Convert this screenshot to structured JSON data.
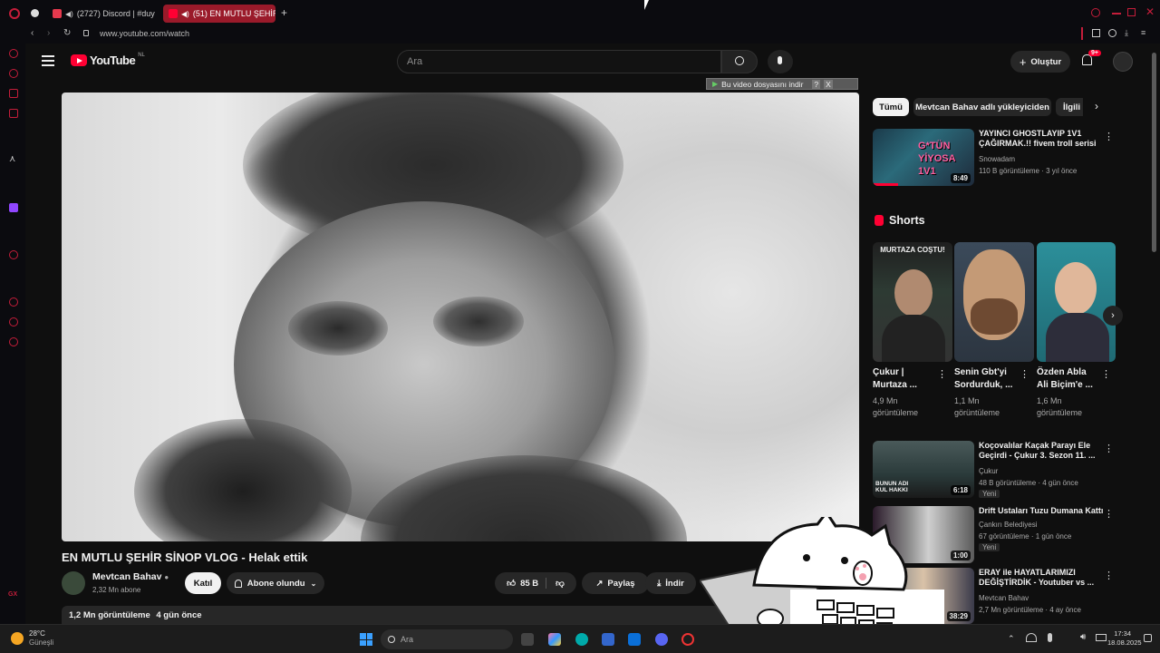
{
  "browser": {
    "tabs": [
      {
        "label": "(2727) Discord | #duy",
        "active": false
      },
      {
        "label": "(51) EN MUTLU ŞEHİR",
        "active": true
      }
    ],
    "new_tab": "+",
    "url": "www.youtube.com/watch"
  },
  "yt": {
    "logo_text": "YouTube",
    "logo_region": "NL",
    "search_placeholder": "Ara",
    "create_label": "Oluştur",
    "notif_badge": "9+",
    "download_bar": "Bu video dosyasını indir",
    "download_bar_help": "?",
    "download_bar_close": "X"
  },
  "video": {
    "title": "EN MUTLU ŞEHİR SİNOP VLOG - Helak ettik",
    "channel": "Mevtcan Bahav",
    "subscribers": "2,32 Mn abone",
    "join_label": "Katıl",
    "subscribed_label": "Abone olundu",
    "likes": "85 B",
    "share_label": "Paylaş",
    "download_label": "İndir",
    "views": "1,2 Mn görüntüleme",
    "age": "4 gün önce"
  },
  "chips": [
    "Tümü",
    "Mevtcan Bahav adlı yükleyiciden",
    "İlgili"
  ],
  "recs_top": [
    {
      "title": "YAYINCI GHOSTLAYIP 1V1 ÇAĞIRMAK.!! fivem troll serisi",
      "channel": "Snowadam",
      "meta": "110 B görüntüleme · 3 yıl önce",
      "duration": "8:49",
      "thumb_text": "G*TÜN YİYOSA 1V1"
    }
  ],
  "shorts_heading": "Shorts",
  "shorts": [
    {
      "title": "Çukur | Murtaza ...",
      "views": "4,9 Mn görüntüleme",
      "overlay": "MURTAZA COŞTU!"
    },
    {
      "title": "Senin Gbt'yi Sordurduk, ...",
      "views": "1,1 Mn görüntüleme",
      "overlay": ""
    },
    {
      "title": "Özden Abla Ali Biçim'e ...",
      "views": "1,6 Mn görüntüleme",
      "overlay": ""
    }
  ],
  "recs": [
    {
      "title": "Koçovalılar Kaçak Parayı Ele Geçirdi - Çukur 3. Sezon 11. ...",
      "channel": "Çukur",
      "meta": "48 B görüntüleme · 4 gün önce",
      "badge": "Yeni",
      "duration": "6:18",
      "thumb_text": "BUNUN ADI KUL HAKKI"
    },
    {
      "title": "Drift Ustaları Tuzu Dumana Kattı",
      "channel": "Çankırı Belediyesi",
      "meta": "67 görüntüleme · 1 gün önce",
      "badge": "Yeni",
      "duration": "1:00",
      "thumb_text": ""
    },
    {
      "title": "ERAY ile HAYATLARIMIZI DEĞİŞTİRDİK - Youtuber vs ...",
      "channel": "Mevtcan Bahav",
      "meta": "2,7 Mn görüntüleme · 4 ay önce",
      "badge": "",
      "duration": "38:29",
      "thumb_text": ""
    }
  ],
  "taskbar": {
    "weather_temp": "28°C",
    "weather_desc": "Güneşli",
    "search_label": "Ara",
    "time": "17:34",
    "date": "18.08.2025"
  },
  "colors": {
    "yt_red": "#ff0033",
    "opera_red": "#c41d3a",
    "tab_active": "#9a1a2a"
  }
}
